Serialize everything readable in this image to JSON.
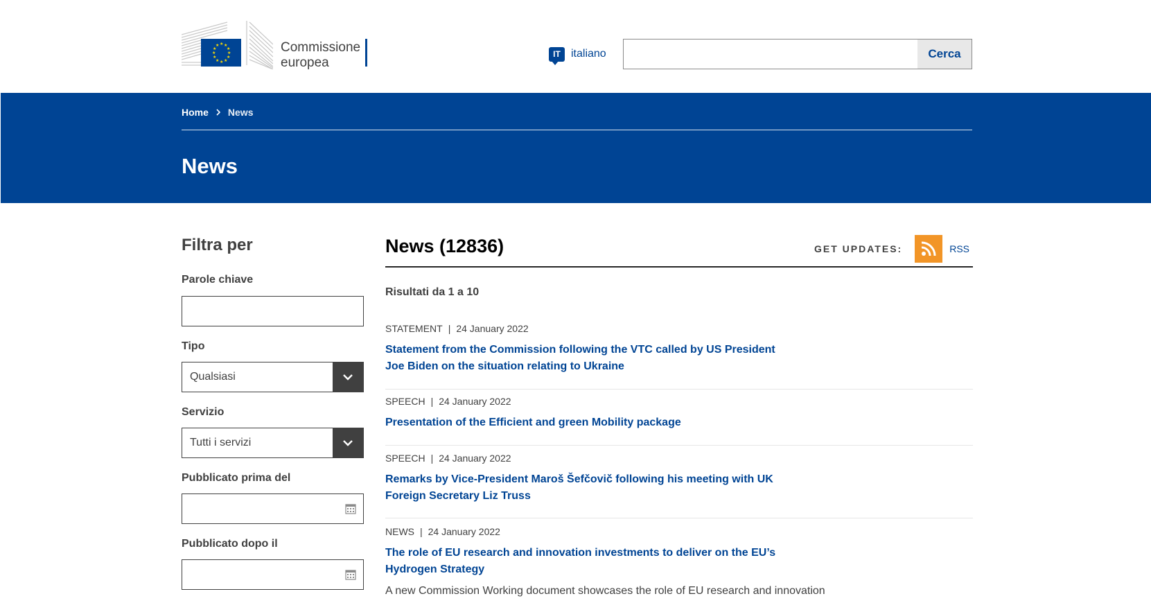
{
  "header": {
    "logo_line1": "Commissione",
    "logo_line2": "europea",
    "language_code": "IT",
    "language_label": "italiano",
    "search_placeholder": "",
    "search_button": "Cerca"
  },
  "banner": {
    "breadcrumb": [
      "Home",
      "News"
    ],
    "title": "News"
  },
  "sidebar": {
    "title": "Filtra per",
    "keywords_label": "Parole chiave",
    "keywords_value": "",
    "type_label": "Tipo",
    "type_value": "Qualsiasi",
    "service_label": "Servizio",
    "service_value": "Tutti i servizi",
    "before_label": "Pubblicato prima del",
    "before_value": "",
    "after_label": "Pubblicato dopo il",
    "after_value": ""
  },
  "main": {
    "title": "News (12836)",
    "updates_label": "GET UPDATES:",
    "rss_label": "RSS",
    "results_text": "Risultati da 1 a 10",
    "items": [
      {
        "type": "STATEMENT",
        "date": "24 January 2022",
        "title": "Statement from the Commission following the VTC called by US President Joe Biden on the situation relating to Ukraine"
      },
      {
        "type": "SPEECH",
        "date": "24 January 2022",
        "title": "Presentation of the Efficient and green Mobility package"
      },
      {
        "type": "SPEECH",
        "date": "24 January 2022",
        "title": "Remarks by Vice-President Maroš Šefčovič following his meeting with UK Foreign Secretary Liz Truss"
      },
      {
        "type": "NEWS",
        "date": "24 January 2022",
        "title": "The role of EU research and innovation investments to deliver on the EU’s Hydrogen Strategy",
        "description": "A new Commission Working document showcases the role of EU research and innovation"
      }
    ]
  },
  "colors": {
    "brand_blue": "#004494",
    "rss_orange": "#f29527",
    "dark_gray": "#404040"
  }
}
